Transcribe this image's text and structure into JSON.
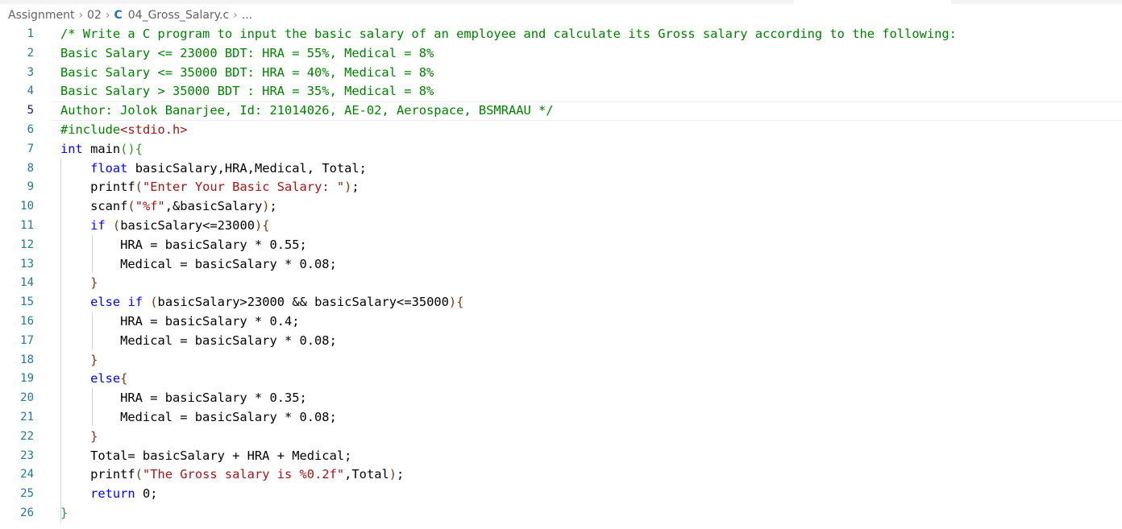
{
  "breadcrumb": {
    "items": [
      "Assignment",
      "02",
      "04_Gross_Salary.c",
      "..."
    ],
    "file_icon": "C"
  },
  "editor": {
    "line_numbers": [
      "1",
      "2",
      "3",
      "4",
      "5",
      "6",
      "7",
      "8",
      "9",
      "10",
      "11",
      "12",
      "13",
      "14",
      "15",
      "16",
      "17",
      "18",
      "19",
      "20",
      "21",
      "22",
      "23",
      "24",
      "25",
      "26"
    ],
    "active_line": "5",
    "lines": [
      [
        {
          "t": "/* Write a C program to input the basic salary of an employee and calculate its Gross salary according to the following:",
          "c": "com"
        }
      ],
      [
        {
          "t": "Basic Salary <= 23000 BDT: HRA = 55%, Medical = 8%",
          "c": "com"
        }
      ],
      [
        {
          "t": "Basic Salary <= 35000 BDT: HRA = 40%, Medical = 8%",
          "c": "com"
        }
      ],
      [
        {
          "t": "Basic Salary > 35000 BDT : HRA = 35%, Medical = 8%",
          "c": "com"
        }
      ],
      [
        {
          "t": "Author: Jolok Banarjee, Id: 21014026, AE-02, Aerospace, BSMRAAU */",
          "c": "com"
        }
      ],
      [
        {
          "t": "#include",
          "c": "com"
        },
        {
          "t": "<stdio.h>",
          "c": "inc2"
        }
      ],
      [
        {
          "t": "int",
          "c": "kw"
        },
        {
          "t": " main",
          "c": ""
        },
        {
          "t": "()",
          "c": "br1"
        },
        {
          "t": "{",
          "c": "br1"
        }
      ],
      [
        {
          "t": "    ",
          "c": ""
        },
        {
          "t": "float",
          "c": "kw"
        },
        {
          "t": " basicSalary,HRA,Medical, Total;",
          "c": ""
        }
      ],
      [
        {
          "t": "    printf",
          "c": ""
        },
        {
          "t": "(",
          "c": "br2"
        },
        {
          "t": "\"Enter Your Basic Salary: \"",
          "c": "str"
        },
        {
          "t": ")",
          "c": "br2"
        },
        {
          "t": ";",
          "c": ""
        }
      ],
      [
        {
          "t": "    scanf",
          "c": ""
        },
        {
          "t": "(",
          "c": "br2"
        },
        {
          "t": "\"%f\"",
          "c": "str"
        },
        {
          "t": ",&basicSalary",
          "c": ""
        },
        {
          "t": ")",
          "c": "br2"
        },
        {
          "t": ";",
          "c": ""
        }
      ],
      [
        {
          "t": "    ",
          "c": ""
        },
        {
          "t": "if",
          "c": "kw"
        },
        {
          "t": " ",
          "c": ""
        },
        {
          "t": "(",
          "c": "br2"
        },
        {
          "t": "basicSalary<=23000",
          "c": ""
        },
        {
          "t": ")",
          "c": "br2"
        },
        {
          "t": "{",
          "c": "br2"
        }
      ],
      [
        {
          "t": "        HRA = basicSalary * 0.55;",
          "c": ""
        }
      ],
      [
        {
          "t": "        Medical = basicSalary * 0.08;",
          "c": ""
        }
      ],
      [
        {
          "t": "    ",
          "c": ""
        },
        {
          "t": "}",
          "c": "br2"
        }
      ],
      [
        {
          "t": "    ",
          "c": ""
        },
        {
          "t": "else",
          "c": "kw"
        },
        {
          "t": " ",
          "c": ""
        },
        {
          "t": "if",
          "c": "kw"
        },
        {
          "t": " ",
          "c": ""
        },
        {
          "t": "(",
          "c": "br2"
        },
        {
          "t": "basicSalary>23000 && basicSalary<=35000",
          "c": ""
        },
        {
          "t": ")",
          "c": "br2"
        },
        {
          "t": "{",
          "c": "br2"
        }
      ],
      [
        {
          "t": "        HRA = basicSalary * 0.4;",
          "c": ""
        }
      ],
      [
        {
          "t": "        Medical = basicSalary * 0.08;",
          "c": ""
        }
      ],
      [
        {
          "t": "    ",
          "c": ""
        },
        {
          "t": "}",
          "c": "br2"
        }
      ],
      [
        {
          "t": "    ",
          "c": ""
        },
        {
          "t": "else",
          "c": "kw"
        },
        {
          "t": "{",
          "c": "br2"
        }
      ],
      [
        {
          "t": "        HRA = basicSalary * 0.35;",
          "c": ""
        }
      ],
      [
        {
          "t": "        Medical = basicSalary * 0.08;",
          "c": ""
        }
      ],
      [
        {
          "t": "    ",
          "c": ""
        },
        {
          "t": "}",
          "c": "br2"
        }
      ],
      [
        {
          "t": "    Total= basicSalary + HRA + Medical;",
          "c": ""
        }
      ],
      [
        {
          "t": "    printf",
          "c": ""
        },
        {
          "t": "(",
          "c": "br2"
        },
        {
          "t": "\"The Gross salary is %0.2f\"",
          "c": "str"
        },
        {
          "t": ",Total",
          "c": ""
        },
        {
          "t": ")",
          "c": "br2"
        },
        {
          "t": ";",
          "c": ""
        }
      ],
      [
        {
          "t": "    ",
          "c": ""
        },
        {
          "t": "return",
          "c": "kw"
        },
        {
          "t": " 0;",
          "c": ""
        }
      ],
      [
        {
          "t": "}",
          "c": "br1"
        }
      ]
    ]
  },
  "colors": {
    "comment": "#008000",
    "keyword": "#0000ff",
    "string": "#a31515",
    "line_number": "#237893",
    "breadcrumb_text": "#616161",
    "c_icon": "#2f6db5"
  }
}
